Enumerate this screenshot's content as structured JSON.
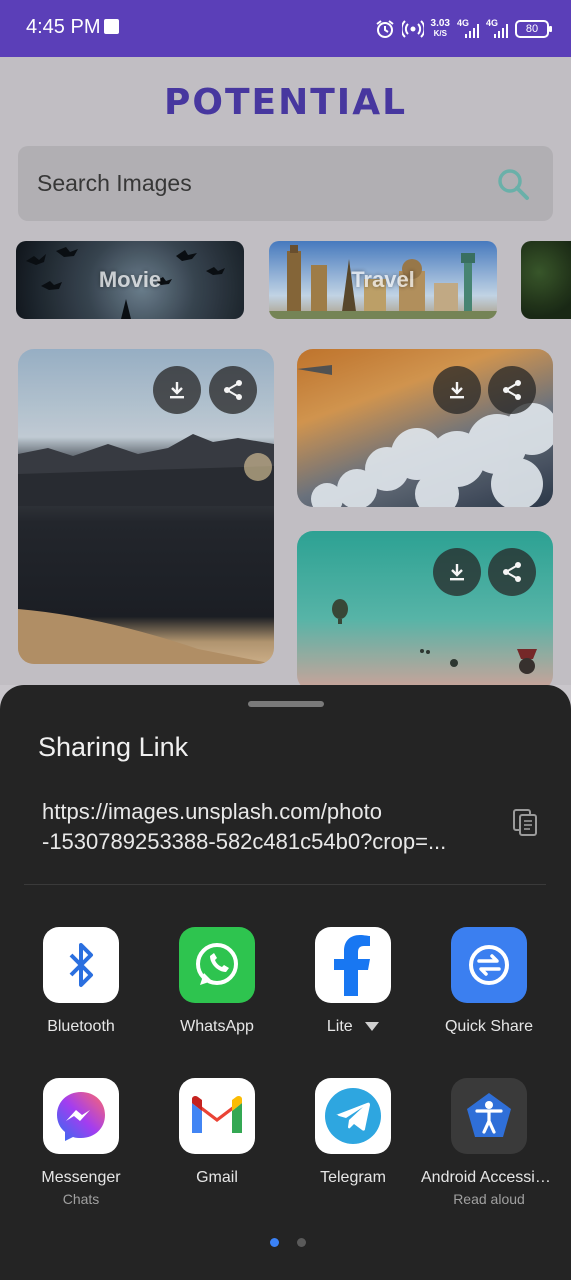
{
  "status_bar": {
    "time": "4:45 PM",
    "speed_value": "3.03",
    "speed_unit": "K/S",
    "net1": "4G",
    "net2": "4G",
    "battery": "80"
  },
  "app": {
    "logo": "POTENTIAL",
    "search_placeholder": "Search Images",
    "categories": [
      {
        "label": "Movie"
      },
      {
        "label": "Travel"
      },
      {
        "label": ""
      }
    ]
  },
  "share_sheet": {
    "title": "Sharing Link",
    "url_line1": "https://images.unsplash.com/photo",
    "url_line2": "-1530789253388-582c481c54b0?crop=...",
    "apps": [
      {
        "name": "Bluetooth",
        "sub": ""
      },
      {
        "name": "WhatsApp",
        "sub": ""
      },
      {
        "name": "Lite",
        "sub": ""
      },
      {
        "name": "Quick Share",
        "sub": ""
      },
      {
        "name": "Messenger",
        "sub": "Chats"
      },
      {
        "name": "Gmail",
        "sub": ""
      },
      {
        "name": "Telegram",
        "sub": ""
      },
      {
        "name": "Android Accessibi...",
        "sub": "Read aloud"
      }
    ]
  },
  "colors": {
    "status_bar": "#5b3fb8",
    "logo": "#4a3aa6",
    "sheet_bg": "#242424",
    "active_dot": "#3b82f6"
  }
}
